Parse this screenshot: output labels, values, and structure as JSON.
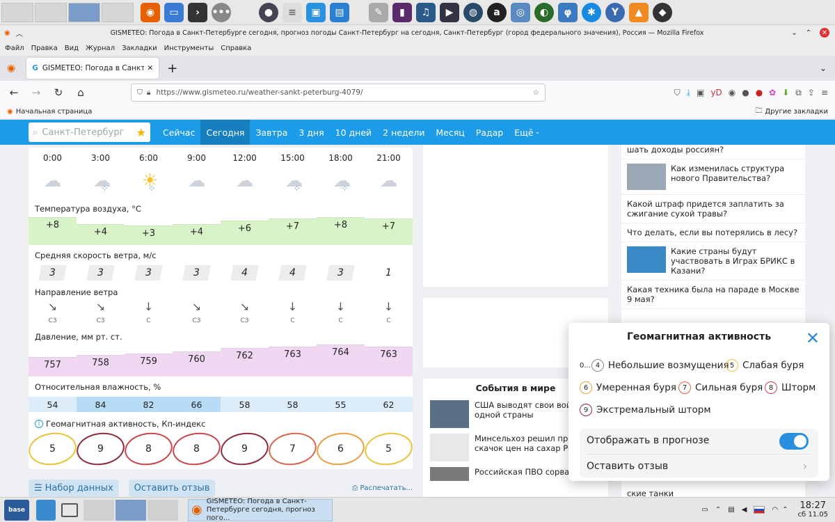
{
  "window": {
    "title": "GISMETEO: Погода в Санкт-Петербурге сегодня, прогноз погоды Санкт-Петербург на сегодня, Санкт-Петербург (город федерального значения), Россия — Mozilla Firefox",
    "menu": [
      "Файл",
      "Правка",
      "Вид",
      "Журнал",
      "Закладки",
      "Инструменты",
      "Справка"
    ],
    "tab_title": "GISMETEO: Погода в Санкт-Пет",
    "url": "https://www.gismeteo.ru/weather-sankt-peterburg-4079/",
    "bookmark_home": "Начальная страница",
    "bookmark_other": "Другие закладки"
  },
  "site": {
    "search_placeholder": "Санкт-Петербург",
    "nav": [
      "Сейчас",
      "Сегодня",
      "Завтра",
      "3 дня",
      "10 дней",
      "2 недели",
      "Месяц",
      "Радар",
      "Ещё"
    ],
    "active_nav": "Сегодня"
  },
  "forecast": {
    "hours": [
      "0:00",
      "3:00",
      "6:00",
      "9:00",
      "12:00",
      "15:00",
      "18:00",
      "21:00"
    ],
    "icons": [
      "cloud-icon",
      "cloud-rain-icon",
      "sun-cloud-rain-icon",
      "cloud-icon",
      "cloud-icon",
      "cloud-rain-icon",
      "cloud-rain-icon",
      "cloud-icon"
    ],
    "temp_label": "Температура воздуха, °C",
    "temps": [
      "+8",
      "+4",
      "+3",
      "+4",
      "+6",
      "+7",
      "+8",
      "+7"
    ],
    "wind_label": "Средняя скорость ветра, м/с",
    "wind": [
      "3",
      "3",
      "3",
      "3",
      "4",
      "4",
      "3",
      "1"
    ],
    "dir_label": "Направление ветра",
    "dirs": [
      "СЗ",
      "СЗ",
      "С",
      "СЗ",
      "СЗ",
      "С",
      "С",
      "С"
    ],
    "pressure_label": "Давление, мм рт. ст.",
    "pressure": [
      "757",
      "758",
      "759",
      "760",
      "762",
      "763",
      "764",
      "763"
    ],
    "humidity_label": "Относительная влажность, %",
    "humidity": [
      "54",
      "84",
      "82",
      "66",
      "58",
      "58",
      "55",
      "62"
    ],
    "geo_label": "Геомагнитная активность, Кп-индекс",
    "geo": [
      "5",
      "9",
      "8",
      "8",
      "9",
      "7",
      "6",
      "5"
    ]
  },
  "footer": {
    "dataset_button": "Набор данных",
    "feedback_button": "Оставить отзыв",
    "print_link": "Распечатать..."
  },
  "events": {
    "title": "События в мире",
    "items": [
      "США выводят свои войск из одной страны",
      "Минсельхоз решил пред дить скачок цен на сахар России",
      "Российская ПВО сорвала"
    ]
  },
  "news": [
    "шать доходы россиян?",
    "Как изменилась структура нового Правительства?",
    "Какой штраф придется заплатить за сжигание сухой травы?",
    "Что делать, если вы потерялись в лесу?",
    "Какие страны будут участвовать в Играх БРИКС в Казани?",
    "Какая техника была на параде в Москве 9 мая?",
    "ские танки"
  ],
  "geo_modal": {
    "title": "Геомагнитная активность",
    "legend": [
      {
        "badge": "0...4",
        "label": "Небольшие возмущения",
        "color": "#888888"
      },
      {
        "badge": "5",
        "label": "Слабая буря",
        "color": "#e8c33a"
      },
      {
        "badge": "6",
        "label": "Умеренная буря",
        "color": "#e8a040"
      },
      {
        "badge": "7",
        "label": "Сильная буря",
        "color": "#d9654a"
      },
      {
        "badge": "8",
        "label": "Шторм",
        "color": "#c8444a"
      },
      {
        "badge": "9",
        "label": "Экстремальный шторм",
        "color": "#8a2a3a"
      }
    ],
    "show_in_forecast": "Отображать в прогнозе",
    "leave_feedback": "Оставить отзыв"
  },
  "taskbar": {
    "window_title": "GISMETEO: Погода в Санкт-Петербурге сегодня, прогноз пого...",
    "time": "18:27",
    "date": "сб 11.05"
  },
  "colors": {
    "site_blue": "#1c9ce8",
    "temp_fill": "#d9f3c8",
    "pressure_fill": "#f0d8f2",
    "humidity_high": "#b8dcf5",
    "humidity_low": "#dcecf9"
  }
}
